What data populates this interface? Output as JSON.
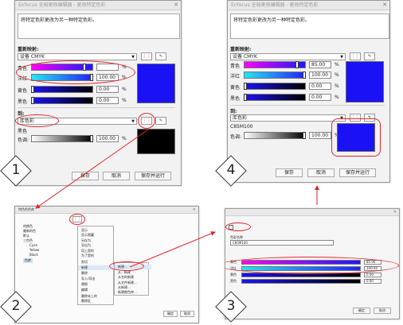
{
  "colors": {
    "accent_red": "#e0262a",
    "swatch_blue": "#1a12f4",
    "swatch_black": "#000000"
  },
  "step1": {
    "title": "Enfocus 全局更改编辑器 - 更改特定色彩",
    "description": "将特定色彩更改为另一种特定色彩。",
    "remap_label": "重新映射:",
    "colorspace": "设备 CMYK",
    "channels": [
      {
        "name": "青色",
        "value": "",
        "level": 0.85
      },
      {
        "name": "洋红",
        "value": "100.00",
        "level": 1.0
      },
      {
        "name": "黄色",
        "value": "0.00",
        "level": 0.0
      },
      {
        "name": "黑色",
        "value": "0.00",
        "level": 0.0
      }
    ],
    "pct": "%",
    "to_label": "到:",
    "target_type": "库色彩",
    "target_name": "黑色",
    "tint_label": "色调:",
    "tint_value": "100.00",
    "buttons": {
      "save": "保存",
      "cancel": "取消",
      "save_run": "保存并运行"
    }
  },
  "step4": {
    "title": "Enfocus 全局更改编辑器 - 更改特定色彩",
    "description": "将特定色彩更改为另一种特定色彩。",
    "remap_label": "重新映射:",
    "colorspace": "设备 CMYK",
    "channels": [
      {
        "name": "青色",
        "value": "85.00",
        "level": 0.85
      },
      {
        "name": "洋红",
        "value": "100.00",
        "level": 1.0
      },
      {
        "name": "黄色",
        "value": "0.00",
        "level": 0.0
      },
      {
        "name": "黑色",
        "value": "0.00",
        "level": 0.0
      }
    ],
    "pct": "%",
    "to_label": "到:",
    "target_type": "库色彩",
    "target_name": "C85M100",
    "tint_label": "色调:",
    "tint_value": "100.00",
    "buttons": {
      "save": "保存",
      "cancel": "取消",
      "save_run": "保存并运行"
    }
  },
  "step2": {
    "title": "特色色色库",
    "tree": [
      "的颜色",
      "最新的色",
      "默认",
      "三色色",
      "Cyan",
      "Yellow",
      "Black",
      "色库"
    ],
    "menu": [
      "显示",
      "显示隐藏",
      "另存为",
      "导出为",
      "用上是的",
      "为了是的",
      "剪切",
      "新建",
      "删除",
      "导入/导出",
      "替换",
      "编辑",
      "删除未上的",
      "删除区"
    ],
    "submenu": [
      "新建...",
      "从...新建",
      "从名的新建",
      "从文件新建...",
      "从新建...",
      "新建颜色库..."
    ],
    "buttons": {
      "ok": "确定",
      "cancel": "取消"
    }
  },
  "step3": {
    "title": "",
    "name_label": "色彩名称",
    "name_value": "C85M100",
    "channels": [
      {
        "name": "青色",
        "value": "85.00",
        "level": 0.85
      },
      {
        "name": "洋红",
        "value": "100.00",
        "level": 1.0
      },
      {
        "name": "黄色",
        "value": "0.00",
        "level": 0.0
      },
      {
        "name": "黑色",
        "value": "0.00",
        "level": 0.0
      }
    ],
    "buttons": {
      "ok": "确定",
      "cancel": "取消"
    }
  },
  "steps": [
    "1",
    "2",
    "3",
    "4"
  ]
}
